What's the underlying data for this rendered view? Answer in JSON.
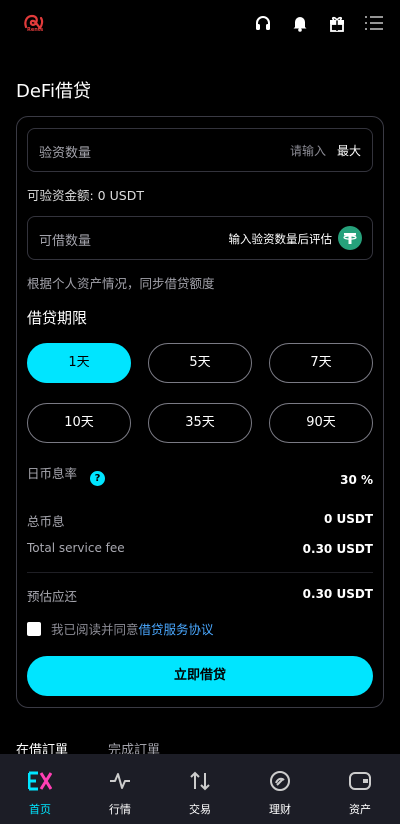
{
  "header": {
    "logo_text": "Rents",
    "icons": [
      "headset-icon",
      "bell-icon",
      "gift-icon",
      "menu-icon"
    ]
  },
  "page": {
    "title": "DeFi借贷"
  },
  "form": {
    "collateral_label": "验资数量",
    "collateral_placeholder": "请输入",
    "max_label": "最大",
    "available_text": "可验资金额: 0 USDT",
    "borrow_label": "可借数量",
    "borrow_hint": "输入验资数量后评估",
    "note": "根据个人资产情况，同步借贷额度",
    "term_title": "借贷期限"
  },
  "durations": [
    {
      "label": "1天",
      "active": true
    },
    {
      "label": "5天",
      "active": false
    },
    {
      "label": "7天",
      "active": false
    },
    {
      "label": "10天",
      "active": false
    },
    {
      "label": "35天",
      "active": false
    },
    {
      "label": "90天",
      "active": false
    }
  ],
  "summary": {
    "daily_rate_label": "日币息率",
    "daily_rate_value": "30 %",
    "total_interest_label": "总币息",
    "total_interest_value": "0 USDT",
    "service_fee_label": "Total service fee",
    "service_fee_value": "0.30 USDT",
    "estimated_repay_label": "预估应还",
    "estimated_repay_value": "0.30 USDT"
  },
  "agreement": {
    "prefix": "我已阅读并同意",
    "link": "借贷服务协议"
  },
  "submit_label": "立即借贷",
  "order_tabs": [
    "在借訂單",
    "完成訂單"
  ],
  "bottom_nav": [
    {
      "label": "首页",
      "active": true
    },
    {
      "label": "行情",
      "active": false
    },
    {
      "label": "交易",
      "active": false
    },
    {
      "label": "理财",
      "active": false
    },
    {
      "label": "资产",
      "active": false
    }
  ],
  "colors": {
    "accent": "#00e5ff",
    "link": "#4aa8ff",
    "tether": "#26a17b",
    "logo": "#e23b3b"
  }
}
